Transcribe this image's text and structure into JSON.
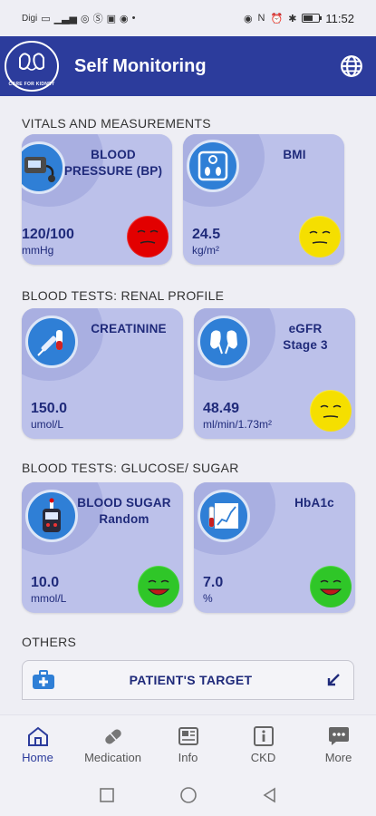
{
  "status_bar": {
    "left_text": "Digi",
    "time": "11:52"
  },
  "app_bar": {
    "logo_text": "CARE FOR KIDNEY",
    "title": "Self Monitoring",
    "globe_icon": "globe-icon"
  },
  "sections": {
    "vitals": "VITALS AND MEASUREMENTS",
    "renal": "BLOOD TESTS: RENAL PROFILE",
    "glucose": "BLOOD TESTS: GLUCOSE/ SUGAR",
    "others": "OTHERS"
  },
  "cards": {
    "bp": {
      "title_1": "BLOOD",
      "title_2": "PRESSURE (BP)",
      "value": "120/100",
      "unit": "mmHg",
      "status": "red"
    },
    "bmi": {
      "title_1": "BMI",
      "value": "24.5",
      "unit": "kg/m²",
      "status": "yellow"
    },
    "creatinine": {
      "title_1": "CREATININE",
      "value": "150.0",
      "unit": "umol/L",
      "status": "none"
    },
    "egfr": {
      "title_1": "eGFR",
      "title_2": "Stage 3",
      "value": "48.49",
      "unit": "ml/min/1.73m²",
      "status": "yellow"
    },
    "sugar": {
      "title_1": "BLOOD SUGAR",
      "title_2": "Random",
      "value": "10.0",
      "unit": "mmol/L",
      "status": "green"
    },
    "hba1c": {
      "title_1": "HbA1c",
      "value": "7.0",
      "unit": "%",
      "status": "green"
    }
  },
  "others": {
    "patient_target": "PATIENT'S TARGET"
  },
  "bottom_nav": {
    "home": "Home",
    "medication": "Medication",
    "info": "Info",
    "ckd": "CKD",
    "more": "More"
  },
  "colors": {
    "primary": "#2c3c9c",
    "card_bg": "#bcc1ea",
    "text_dark": "#1f2a7a",
    "red": "#e00000",
    "yellow": "#f5df00",
    "green": "#2fc628"
  }
}
